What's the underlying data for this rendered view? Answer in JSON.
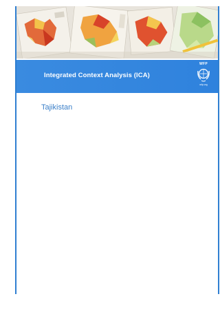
{
  "cover": {
    "title": "Integrated Context Analysis (ICA)",
    "country": "Tajikistan",
    "logo": {
      "acronym": "WFP",
      "url": "wfp.org",
      "icon": "wfp-emblem-icon"
    },
    "hero_image": "maps-photo"
  },
  "colors": {
    "banner": "#2f82dd",
    "border": "#2f7fd1",
    "country_text": "#3a7fc8"
  }
}
